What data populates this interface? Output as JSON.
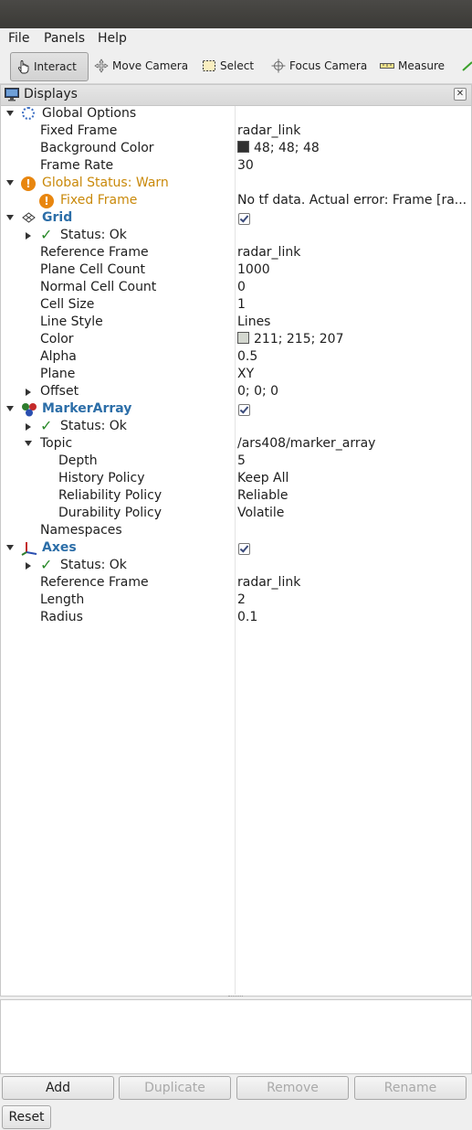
{
  "menu": {
    "file": "File",
    "panels": "Panels",
    "help": "Help"
  },
  "toolbar": {
    "interact": "Interact",
    "move_camera": "Move Camera",
    "select": "Select",
    "focus_camera": "Focus Camera",
    "measure": "Measure"
  },
  "panel": {
    "title": "Displays",
    "close": "✕"
  },
  "tree": {
    "global_options": "Global Options",
    "fixed_frame_label": "Fixed Frame",
    "fixed_frame_value": "radar_link",
    "background_color_label": "Background Color",
    "background_color_value": "48; 48; 48",
    "background_color_hex": "#303030",
    "frame_rate_label": "Frame Rate",
    "frame_rate_value": "30",
    "global_status": "Global Status: Warn",
    "fixed_frame_warn_label": "Fixed Frame",
    "fixed_frame_warn_value": "No tf data.  Actual error: Frame [ra...",
    "grid": {
      "name": "Grid",
      "status": "Status: Ok",
      "reference_frame_label": "Reference Frame",
      "reference_frame_value": "radar_link",
      "plane_cell_count_label": "Plane Cell Count",
      "plane_cell_count_value": "1000",
      "normal_cell_count_label": "Normal Cell Count",
      "normal_cell_count_value": "0",
      "cell_size_label": "Cell Size",
      "cell_size_value": "1",
      "line_style_label": "Line Style",
      "line_style_value": "Lines",
      "color_label": "Color",
      "color_value": "211; 215; 207",
      "color_hex": "#d3d7cf",
      "alpha_label": "Alpha",
      "alpha_value": "0.5",
      "plane_label": "Plane",
      "plane_value": "XY",
      "offset_label": "Offset",
      "offset_value": "0; 0; 0"
    },
    "marker_array": {
      "name": "MarkerArray",
      "status": "Status: Ok",
      "topic_label": "Topic",
      "topic_value": "/ars408/marker_array",
      "depth_label": "Depth",
      "depth_value": "5",
      "history_policy_label": "History Policy",
      "history_policy_value": "Keep All",
      "reliability_policy_label": "Reliability Policy",
      "reliability_policy_value": "Reliable",
      "durability_policy_label": "Durability Policy",
      "durability_policy_value": "Volatile",
      "namespaces_label": "Namespaces"
    },
    "axes": {
      "name": "Axes",
      "status": "Status: Ok",
      "reference_frame_label": "Reference Frame",
      "reference_frame_value": "radar_link",
      "length_label": "Length",
      "length_value": "2",
      "radius_label": "Radius",
      "radius_value": "0.1"
    }
  },
  "buttons": {
    "add": "Add",
    "duplicate": "Duplicate",
    "remove": "Remove",
    "rename": "Rename",
    "reset": "Reset"
  },
  "colors": {
    "accent_blue": "#2c6ea8",
    "warn": "#c9890a",
    "ok_green": "#2a8a2a"
  }
}
